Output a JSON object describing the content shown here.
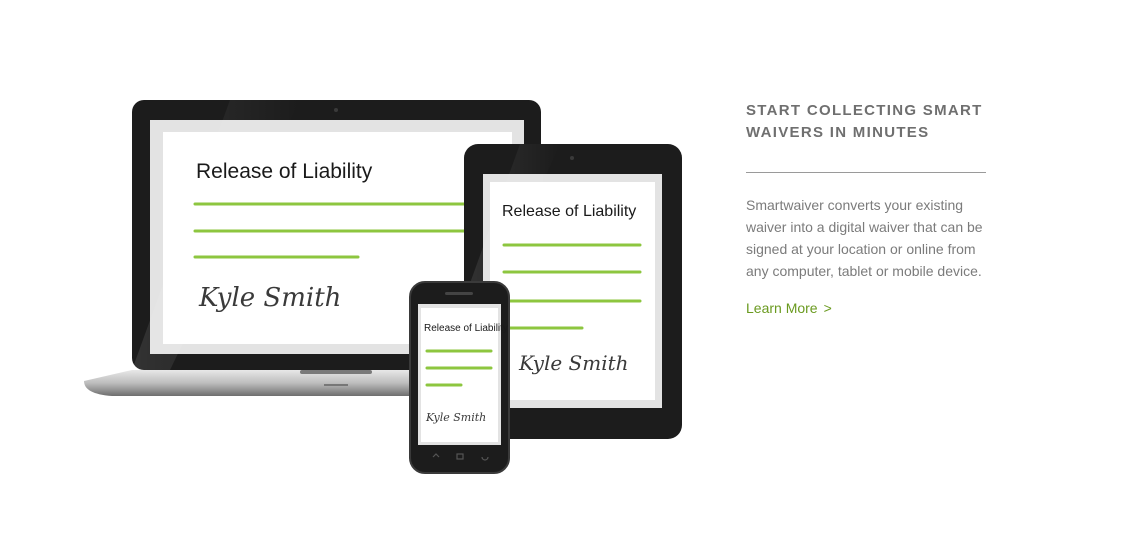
{
  "devices": {
    "laptop": {
      "doc_title": "Release of Liability",
      "signature": "Kyle Smith"
    },
    "tablet": {
      "doc_title": "Release of Liability",
      "signature": "Kyle Smith"
    },
    "phone": {
      "doc_title": "Release of Liability",
      "signature": "Kyle Smith"
    }
  },
  "info": {
    "heading_line1": "START COLLECTING SMART",
    "heading_line2": "WAIVERS IN MINUTES",
    "body": "Smartwaiver converts your existing waiver into a digital waiver that can be signed at your location or online from any computer, tablet or mobile device.",
    "learn_more_label": "Learn More",
    "learn_more_chevron": ">"
  },
  "colors": {
    "accent_green": "#8dc63f",
    "link_green": "#6a9a1f",
    "device_black": "#1c1c1c",
    "text_gray": "#7b7b7b"
  },
  "icons": [
    "laptop-device",
    "tablet-device",
    "phone-device",
    "signature-mark"
  ]
}
